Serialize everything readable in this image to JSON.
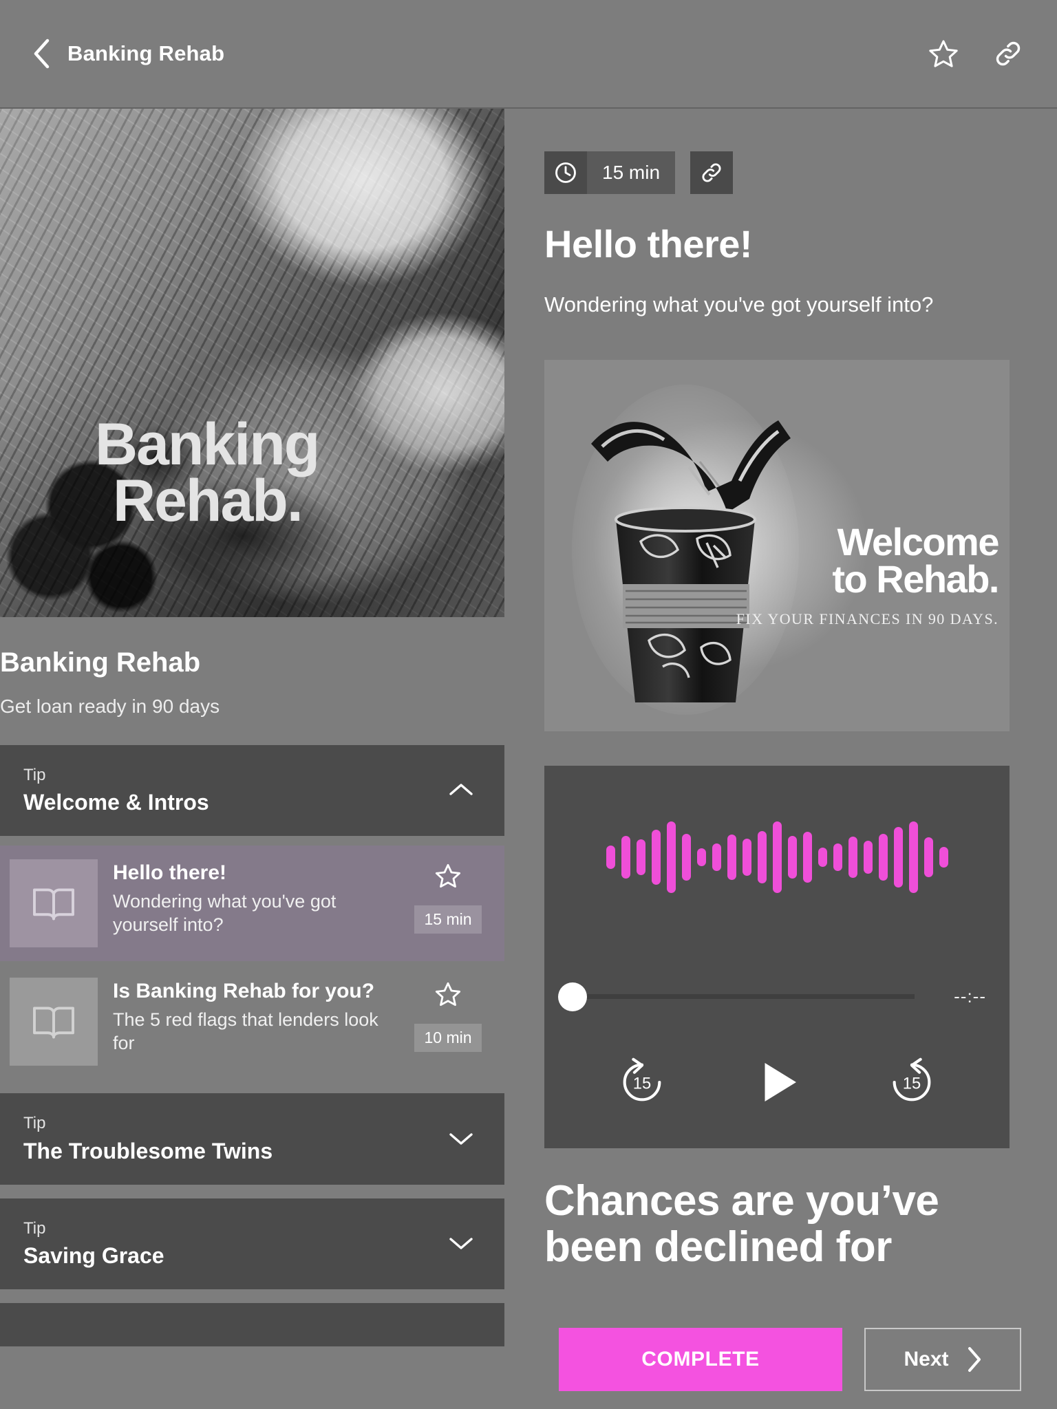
{
  "topbar": {
    "title": "Banking Rehab",
    "back_icon": "chevron-left-icon",
    "favorite_icon": "star-outline-icon",
    "share_icon": "link-icon"
  },
  "course": {
    "cover_title_line1": "Banking",
    "cover_title_line2": "Rehab.",
    "title": "Banking Rehab",
    "subtitle": "Get loan ready in 90 days"
  },
  "sections": [
    {
      "kicker": "Tip",
      "title": "Welcome & Intros",
      "expanded": true,
      "chevron": "chevron-up-icon",
      "lessons": [
        {
          "title": "Hello there!",
          "subtitle": "Wondering what you've got yourself into?",
          "duration": "15 min",
          "icon": "open-book-icon",
          "favorite_icon": "star-outline-icon",
          "active": true
        },
        {
          "title": "Is Banking Rehab for you?",
          "subtitle": "The 5 red flags that lenders look for",
          "duration": "10 min",
          "icon": "open-book-icon",
          "favorite_icon": "star-outline-icon",
          "active": false
        }
      ]
    },
    {
      "kicker": "Tip",
      "title": "The Troublesome Twins",
      "expanded": false,
      "chevron": "chevron-down-icon",
      "lessons": []
    },
    {
      "kicker": "Tip",
      "title": "Saving Grace",
      "expanded": false,
      "chevron": "chevron-down-icon",
      "lessons": []
    },
    {
      "kicker": "",
      "title": "",
      "expanded": false,
      "chevron": "chevron-down-icon",
      "lessons": []
    }
  ],
  "detail": {
    "duration_chip": "15 min",
    "clock_icon": "clock-icon",
    "share_icon": "link-icon",
    "heading": "Hello there!",
    "lead": "Wondering what you've got yourself into?",
    "hero": {
      "title_line1": "Welcome",
      "title_line2": "to Rehab.",
      "subtitle": "FIX YOUR FINANCES IN 90 DAYS.",
      "art": "cup-with-straw-illustration"
    },
    "body_heading": "Chances are you’ve been declined for"
  },
  "player": {
    "time_display": "--:--",
    "progress_percent": 0,
    "play_icon": "play-icon",
    "rewind_label": "15",
    "rewind_icon": "rewind-15-icon",
    "forward_label": "15",
    "forward_icon": "forward-15-icon",
    "waveform_heights": [
      34,
      62,
      52,
      80,
      104,
      68,
      26,
      40,
      66,
      54,
      76,
      104,
      62,
      74,
      28,
      40,
      60,
      48,
      68,
      88,
      104,
      58,
      30
    ],
    "waveform_color": "#ef4fd8"
  },
  "actions": {
    "complete_label": "COMPLETE",
    "complete_color": "#f452e0",
    "next_label": "Next",
    "next_icon": "chevron-right-icon"
  }
}
